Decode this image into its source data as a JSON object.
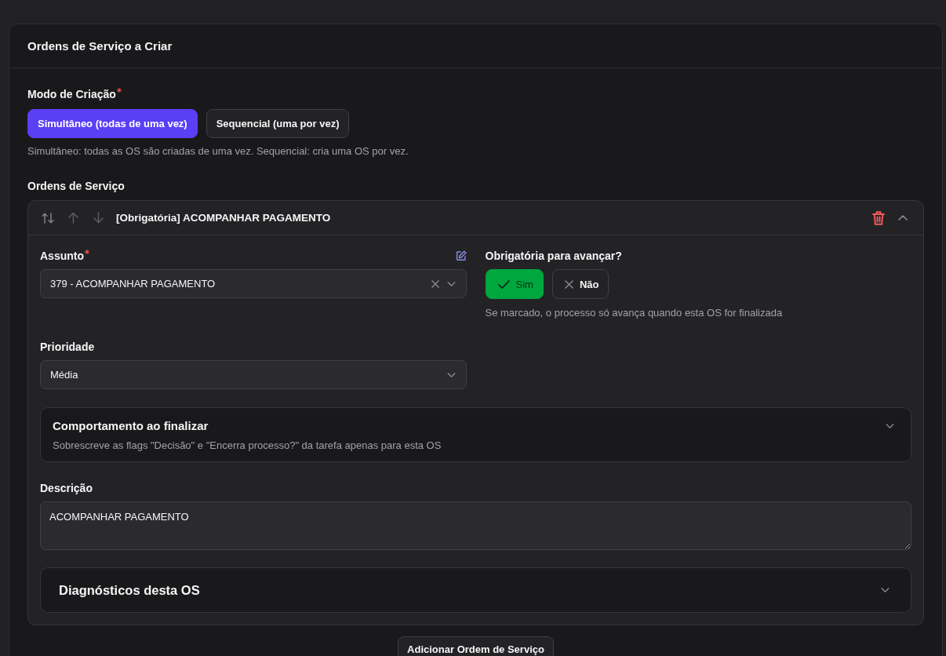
{
  "panel": {
    "title": "Ordens de Serviço a Criar"
  },
  "creation_mode": {
    "label": "Modo de Criação",
    "required": true,
    "options": [
      {
        "label": "Simultâneo (todas de uma vez)",
        "selected": true
      },
      {
        "label": "Sequencial (uma por vez)",
        "selected": false
      }
    ],
    "help": "Simultâneo: todas as OS são criadas de uma vez. Sequencial: cria uma OS por vez."
  },
  "service_orders": {
    "label": "Ordens de Serviço",
    "items": [
      {
        "title": "[Obrigatória] ACOMPANHAR PAGAMENTO",
        "expanded": true,
        "subject": {
          "label": "Assunto",
          "required": true,
          "value": "379 - ACOMPANHAR PAGAMENTO"
        },
        "mandatory": {
          "label": "Obrigatória para avançar?",
          "options": [
            {
              "label": "Sim",
              "kind": "yes",
              "selected": true
            },
            {
              "label": "Não",
              "kind": "no",
              "selected": false
            }
          ],
          "help": "Se marcado, o processo só avança quando esta OS for finalizada"
        },
        "priority": {
          "label": "Prioridade",
          "value": "Média"
        },
        "on_finish": {
          "title": "Comportamento ao finalizar",
          "description": "Sobrescreve as flags \"Decisão\" e \"Encerra processo?\" da tarefa apenas para esta OS",
          "expanded": false
        },
        "description": {
          "label": "Descrição",
          "value": "ACOMPANHAR PAGAMENTO"
        },
        "diagnostics": {
          "title": "Diagnósticos desta OS",
          "expanded": false
        }
      }
    ]
  },
  "add_button": {
    "label": "Adicionar Ordem de Serviço"
  }
}
